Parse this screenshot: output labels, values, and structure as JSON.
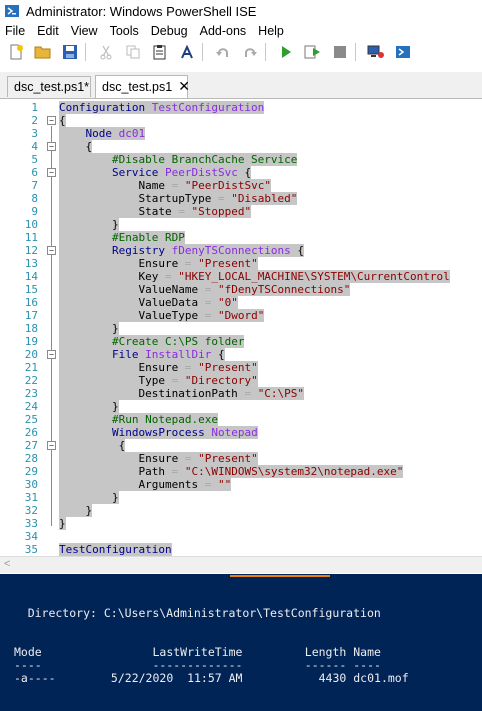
{
  "window": {
    "title": "Administrator: Windows PowerShell ISE"
  },
  "menu": [
    "File",
    "Edit",
    "View",
    "Tools",
    "Debug",
    "Add-ons",
    "Help"
  ],
  "toolbar": [
    "new-icon",
    "open-icon",
    "save-icon",
    "cut-icon",
    "copy-icon",
    "paste-icon",
    "powershell-icon",
    "undo-icon",
    "redo-icon",
    "run-icon",
    "run-selection-icon",
    "stop-icon",
    "remote-icon",
    "console-icon"
  ],
  "tabs": [
    {
      "label": "dsc_test.ps1*",
      "active": false
    },
    {
      "label": "dsc_test.ps1",
      "active": true,
      "close": "✕"
    }
  ],
  "editor": {
    "lines": [
      {
        "n": "1",
        "fold": "",
        "segs": [
          [
            "kw",
            "Configuration "
          ],
          [
            "id",
            "TestConfiguration"
          ]
        ]
      },
      {
        "n": "2",
        "fold": "⊟",
        "segs": [
          [
            "",
            "{"
          ]
        ]
      },
      {
        "n": "3",
        "fold": "",
        "segs": [
          [
            "",
            "    "
          ],
          [
            "kw",
            "Node "
          ],
          [
            "id",
            "dc01"
          ]
        ]
      },
      {
        "n": "4",
        "fold": "⊟",
        "segs": [
          [
            "",
            "    {"
          ]
        ]
      },
      {
        "n": "5",
        "fold": "",
        "segs": [
          [
            "",
            "        "
          ],
          [
            "cmt",
            "#Disable BranchCache Service"
          ]
        ]
      },
      {
        "n": "6",
        "fold": "⊟",
        "segs": [
          [
            "",
            "        "
          ],
          [
            "kw",
            "Service "
          ],
          [
            "id",
            "PeerDistSvc"
          ],
          [
            "",
            " {"
          ]
        ]
      },
      {
        "n": "7",
        "fold": "",
        "segs": [
          [
            "",
            "            Name "
          ],
          [
            "op",
            "= "
          ],
          [
            "str",
            "\"PeerDistSvc\""
          ]
        ]
      },
      {
        "n": "8",
        "fold": "",
        "segs": [
          [
            "",
            "            StartupType "
          ],
          [
            "op",
            "= "
          ],
          [
            "str",
            "\"Disabled\""
          ]
        ]
      },
      {
        "n": "9",
        "fold": "",
        "segs": [
          [
            "",
            "            State "
          ],
          [
            "op",
            "= "
          ],
          [
            "str",
            "\"Stopped\""
          ]
        ]
      },
      {
        "n": "10",
        "fold": "",
        "segs": [
          [
            "",
            "        }"
          ]
        ]
      },
      {
        "n": "11",
        "fold": "",
        "segs": [
          [
            "",
            "        "
          ],
          [
            "cmt",
            "#Enable RDP"
          ]
        ]
      },
      {
        "n": "12",
        "fold": "⊟",
        "segs": [
          [
            "",
            "        "
          ],
          [
            "kw",
            "Registry "
          ],
          [
            "id",
            "fDenyTSConnections"
          ],
          [
            "",
            " {"
          ]
        ]
      },
      {
        "n": "13",
        "fold": "",
        "segs": [
          [
            "",
            "            Ensure "
          ],
          [
            "op",
            "= "
          ],
          [
            "str",
            "\"Present\""
          ]
        ]
      },
      {
        "n": "14",
        "fold": "",
        "segs": [
          [
            "",
            "            Key "
          ],
          [
            "op",
            "= "
          ],
          [
            "str",
            "\"HKEY_LOCAL_MACHINE\\SYSTEM\\CurrentControl"
          ]
        ]
      },
      {
        "n": "15",
        "fold": "",
        "segs": [
          [
            "",
            "            ValueName "
          ],
          [
            "op",
            "= "
          ],
          [
            "str",
            "\"fDenyTSConnections\""
          ]
        ]
      },
      {
        "n": "16",
        "fold": "",
        "segs": [
          [
            "",
            "            ValueData "
          ],
          [
            "op",
            "= "
          ],
          [
            "str",
            "\"0\""
          ]
        ]
      },
      {
        "n": "17",
        "fold": "",
        "segs": [
          [
            "",
            "            ValueType "
          ],
          [
            "op",
            "= "
          ],
          [
            "str",
            "\"Dword\""
          ]
        ]
      },
      {
        "n": "18",
        "fold": "",
        "segs": [
          [
            "",
            "        }"
          ]
        ]
      },
      {
        "n": "19",
        "fold": "",
        "segs": [
          [
            "",
            "        "
          ],
          [
            "cmt",
            "#Create C:\\PS folder"
          ]
        ]
      },
      {
        "n": "20",
        "fold": "⊟",
        "segs": [
          [
            "",
            "        "
          ],
          [
            "kw",
            "File "
          ],
          [
            "id",
            "InstallDir"
          ],
          [
            "",
            " {"
          ]
        ]
      },
      {
        "n": "21",
        "fold": "",
        "segs": [
          [
            "",
            "            Ensure "
          ],
          [
            "op",
            "= "
          ],
          [
            "str",
            "\"Present\""
          ]
        ]
      },
      {
        "n": "22",
        "fold": "",
        "segs": [
          [
            "",
            "            Type "
          ],
          [
            "op",
            "= "
          ],
          [
            "str",
            "\"Directory\""
          ]
        ]
      },
      {
        "n": "23",
        "fold": "",
        "segs": [
          [
            "",
            "            DestinationPath "
          ],
          [
            "op",
            "= "
          ],
          [
            "str",
            "\"C:\\PS\""
          ]
        ]
      },
      {
        "n": "24",
        "fold": "",
        "segs": [
          [
            "",
            "        }"
          ]
        ]
      },
      {
        "n": "25",
        "fold": "",
        "segs": [
          [
            "",
            "        "
          ],
          [
            "cmt",
            "#Run Notepad.exe"
          ]
        ]
      },
      {
        "n": "26",
        "fold": "",
        "segs": [
          [
            "",
            "        "
          ],
          [
            "kw",
            "WindowsProcess "
          ],
          [
            "id",
            "Notepad"
          ]
        ]
      },
      {
        "n": "27",
        "fold": "⊟",
        "segs": [
          [
            "",
            "         {"
          ]
        ]
      },
      {
        "n": "28",
        "fold": "",
        "segs": [
          [
            "",
            "            Ensure "
          ],
          [
            "op",
            "= "
          ],
          [
            "str",
            "\"Present\""
          ]
        ]
      },
      {
        "n": "29",
        "fold": "",
        "segs": [
          [
            "",
            "            Path "
          ],
          [
            "op",
            "= "
          ],
          [
            "str",
            "\"C:\\WINDOWS\\system32\\notepad.exe\""
          ]
        ]
      },
      {
        "n": "30",
        "fold": "",
        "segs": [
          [
            "",
            "            Arguments "
          ],
          [
            "op",
            "= "
          ],
          [
            "str",
            "\"\""
          ]
        ]
      },
      {
        "n": "31",
        "fold": "",
        "segs": [
          [
            "",
            "        }"
          ]
        ]
      },
      {
        "n": "32",
        "fold": "",
        "segs": [
          [
            "",
            "    }"
          ]
        ]
      },
      {
        "n": "33",
        "fold": "",
        "segs": [
          [
            "",
            "}"
          ]
        ]
      },
      {
        "n": "34",
        "fold": "",
        "segs": []
      },
      {
        "n": "35",
        "fold": "",
        "segs": [
          [
            "kw",
            "TestConfiguration"
          ]
        ]
      }
    ]
  },
  "console": {
    "directory": "    Directory: C:\\Users\\Administrator\\TestConfiguration",
    "header": "Mode                LastWriteTime         Length Name",
    "underline": "----                -------------         ------ ----",
    "row": "-a----        5/22/2020  11:57 AM           4430 dc01.mof"
  },
  "colors": {
    "console_bg": "#012456",
    "keyword": "#00008b",
    "identifier": "#8a2be2",
    "string": "#8b0000",
    "comment": "#006400"
  }
}
